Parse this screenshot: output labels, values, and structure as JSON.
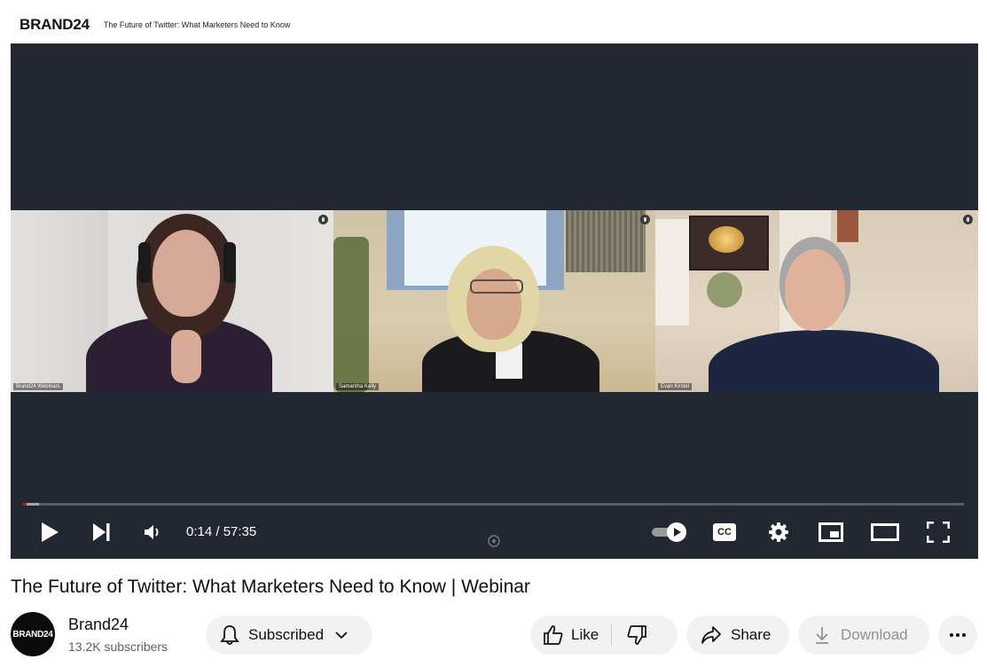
{
  "brand": {
    "logo_text": "BRAND24",
    "subtitle": "The Future of Twitter: What Marketers Need to Know"
  },
  "participants": [
    {
      "name": "Brand24 Webinars"
    },
    {
      "name": "Samantha Kelly"
    },
    {
      "name": "Evan Kirstel"
    }
  ],
  "player": {
    "current_time": "0:14",
    "duration": "57:35",
    "time_display": "0:14 / 57:35",
    "progress_fraction": 0.004,
    "buffered_fraction": 0.017,
    "captions_label": "CC"
  },
  "video": {
    "title": "The Future of Twitter: What Marketers Need to Know | Webinar"
  },
  "channel": {
    "avatar_text": "BRAND24",
    "name": "Brand24",
    "subscribers": "13.2K subscribers"
  },
  "actions": {
    "subscribed_label": "Subscribed",
    "like_label": "Like",
    "share_label": "Share",
    "download_label": "Download"
  },
  "colors": {
    "player_bg": "#222732",
    "progress": "#ff0000",
    "pill_bg": "#f2f2f2"
  }
}
